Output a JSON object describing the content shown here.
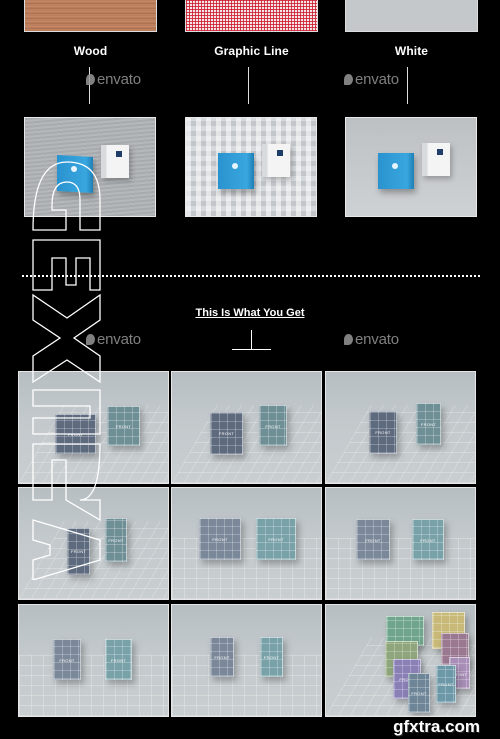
{
  "backgrounds": {
    "swatches": [
      {
        "label": "Wood",
        "pattern": "wood"
      },
      {
        "label": "Graphic Line",
        "pattern": "red-gingham"
      },
      {
        "label": "White",
        "pattern": "plain-grey"
      }
    ],
    "previews": [
      {
        "name": "wood-preview",
        "products": [
          "blue-box",
          "white-box"
        ]
      },
      {
        "name": "graphic-line-preview",
        "products": [
          "blue-box",
          "white-box"
        ]
      },
      {
        "name": "white-preview",
        "products": [
          "blue-box",
          "white-box"
        ]
      }
    ]
  },
  "section": {
    "title": "This Is What You Get"
  },
  "mockups": {
    "box_label": "FRONT",
    "tiles": [
      {
        "view": "isometric-square-boxes"
      },
      {
        "view": "angled-tall-boxes"
      },
      {
        "view": "angled-tall-boxes-right"
      },
      {
        "view": "isometric-side-angle"
      },
      {
        "view": "front-wide-boxes"
      },
      {
        "view": "front-wide-boxes-alt"
      },
      {
        "view": "front-tall-boxes"
      },
      {
        "view": "front-narrow-boxes"
      },
      {
        "view": "multi-colored-boxes-stack"
      }
    ]
  },
  "watermarks": {
    "envato": "envato",
    "site": "gfxtra.com",
    "vertical": "GFXTRA"
  },
  "colors": {
    "background": "#000000",
    "text": "#ffffff",
    "product_blue": "#2a93cf"
  }
}
